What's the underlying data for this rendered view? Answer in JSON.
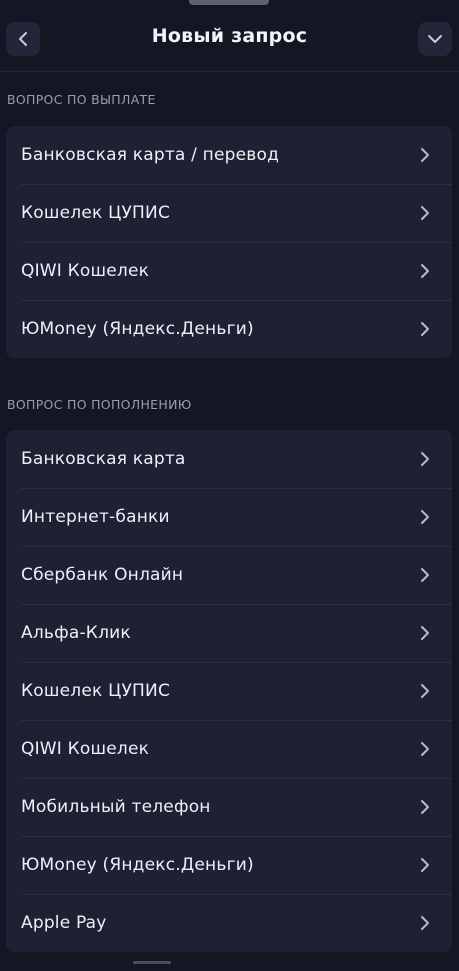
{
  "header": {
    "title": "Новый запрос",
    "back_icon": "chevron-left-icon",
    "collapse_icon": "chevron-down-icon"
  },
  "payout": {
    "section_label": "ВОПРОС ПО ВЫПЛАТЕ",
    "items": [
      {
        "label": "Банковская карта / перевод"
      },
      {
        "label": "Кошелек ЦУПИС"
      },
      {
        "label": "QIWI Кошелек"
      },
      {
        "label": "ЮMoney (Яндекс.Деньги)"
      }
    ]
  },
  "deposit": {
    "section_label": "ВОПРОС ПО ПОПОЛНЕНИЮ",
    "items": [
      {
        "label": "Банковская карта"
      },
      {
        "label": "Интернет-банки"
      },
      {
        "label": "Сбербанк Онлайн"
      },
      {
        "label": "Альфа-Клик"
      },
      {
        "label": "Кошелек ЦУПИС"
      },
      {
        "label": "QIWI Кошелек"
      },
      {
        "label": "Мобильный телефон"
      },
      {
        "label": "ЮMoney (Яндекс.Деньги)"
      },
      {
        "label": "Apple Pay"
      }
    ]
  },
  "colors": {
    "background": "#141624",
    "card": "#1e2133",
    "text": "#eef0f6",
    "muted": "#9a9daf"
  }
}
